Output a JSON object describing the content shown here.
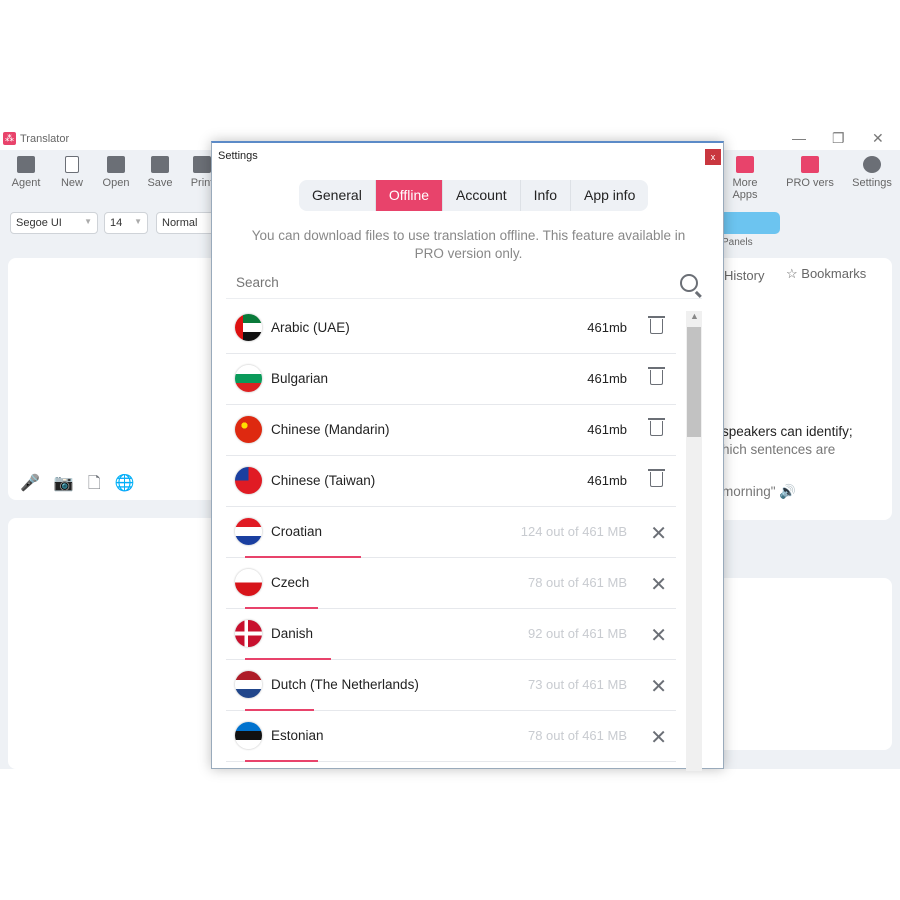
{
  "app": {
    "title": "Translator",
    "toolbar": [
      "Agent",
      "New",
      "Open",
      "Save",
      "Print"
    ],
    "toolbar_right": [
      "More Apps",
      "PRO vers",
      "Settings"
    ],
    "font": "Segoe UI",
    "size": "14",
    "style": "Normal",
    "panels_label": "Panels",
    "right_tabs": [
      "History",
      "Bookmarks"
    ],
    "right_text": [
      "speakers can identify;",
      "hich sentences are",
      "morning\""
    ]
  },
  "dialog": {
    "title": "Settings",
    "close": "x",
    "tabs": [
      "General",
      "Offline",
      "Account",
      "Info",
      "App info"
    ],
    "active_tab": "Offline",
    "description": "You can download files to use translation offline. This feature available in PRO version only.",
    "search_placeholder": "Search",
    "languages": [
      {
        "name": "Arabic (UAE)",
        "size": "461mb",
        "flag": "ae",
        "action": "trash-icon"
      },
      {
        "name": "Bulgarian",
        "size": "461mb",
        "flag": "bg",
        "action": "trash-icon"
      },
      {
        "name": "Chinese (Mandarin)",
        "size": "461mb",
        "flag": "cn",
        "action": "trash-icon"
      },
      {
        "name": "Chinese (Taiwan)",
        "size": "461mb",
        "flag": "tw",
        "action": "trash-icon"
      },
      {
        "name": "Croatian",
        "size": "124 out of 461 MB",
        "progress": 0.27,
        "flag": "hr",
        "action": "close-icon"
      },
      {
        "name": "Czech",
        "size": "78 out of 461 MB",
        "progress": 0.17,
        "flag": "cz",
        "action": "close-icon"
      },
      {
        "name": "Danish",
        "size": "92 out of 461 MB",
        "progress": 0.2,
        "flag": "dk",
        "action": "close-icon"
      },
      {
        "name": "Dutch (The Netherlands)",
        "size": "73 out of 461 MB",
        "progress": 0.16,
        "flag": "nl",
        "action": "close-icon"
      },
      {
        "name": "Estonian",
        "size": "78 out of 461 MB",
        "progress": 0.17,
        "flag": "ee",
        "action": "close-icon"
      }
    ]
  },
  "colors": {
    "accent": "#e8436b",
    "close": "#c9373f"
  }
}
